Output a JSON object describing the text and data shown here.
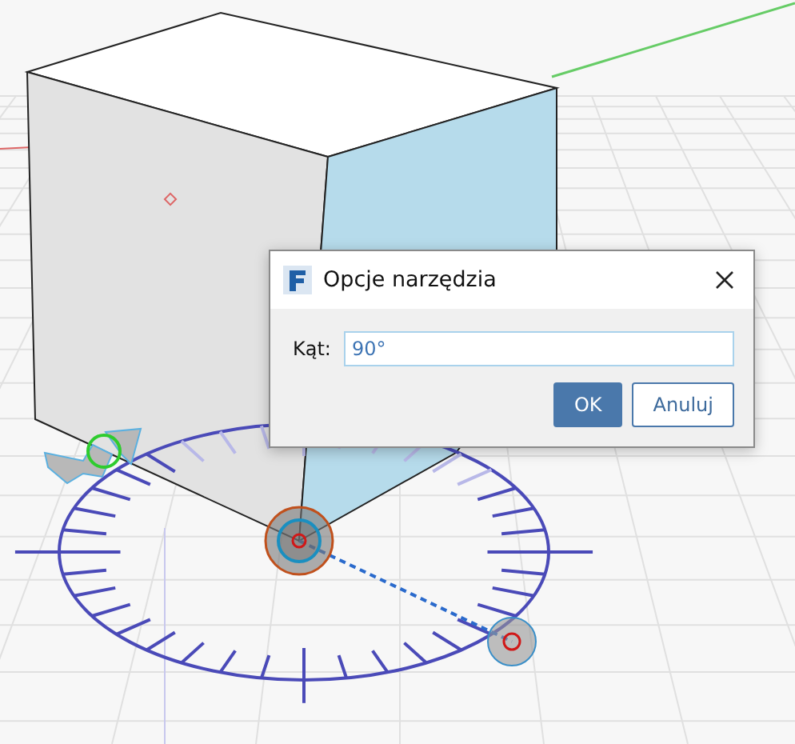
{
  "dialog": {
    "title": "Opcje narzędzia",
    "field": {
      "label": "Kąt:",
      "value": "90°"
    },
    "buttons": [
      {
        "label": "OK",
        "primary": true
      },
      {
        "label": "Anuluj",
        "primary": false
      }
    ]
  }
}
